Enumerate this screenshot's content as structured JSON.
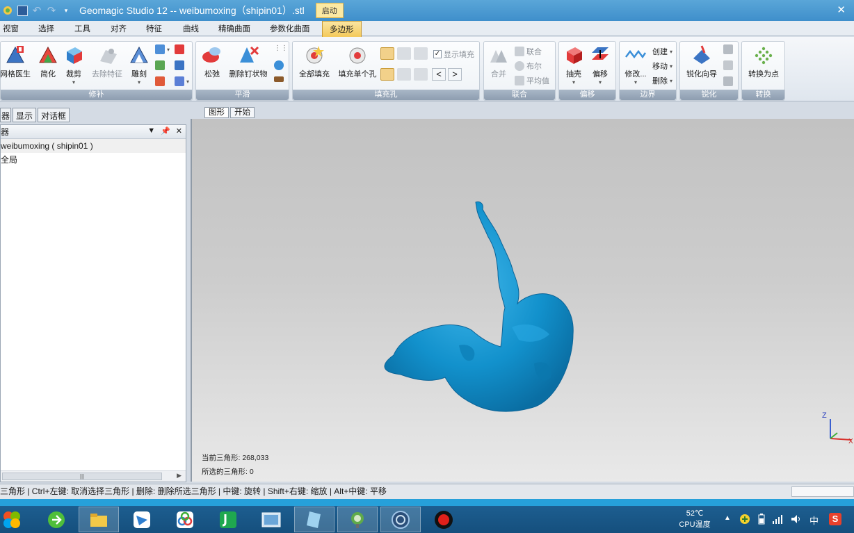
{
  "window": {
    "title": "Geomagic Studio 12 -- weibumoxing（shipin01）.stl",
    "badge": "启动",
    "close_glyph": "✕"
  },
  "menu": {
    "tabs": [
      "视窗",
      "选择",
      "工具",
      "对齐",
      "特征",
      "曲线",
      "精确曲面",
      "参数化曲面",
      "多边形"
    ],
    "active": "多边形"
  },
  "ribbon": {
    "groups": {
      "repair": {
        "label": "修补",
        "items": [
          "网格医生",
          "简化",
          "裁剪",
          "去除特征",
          "雕刻"
        ]
      },
      "smooth": {
        "label": "平滑",
        "items": [
          "松弛",
          "删除钉状物"
        ]
      },
      "fill": {
        "label": "填充孔",
        "items": [
          "全部填充",
          "填充单个孔"
        ],
        "show_fill": "显示填充"
      },
      "merge": {
        "label": "联合",
        "items": [
          "合并",
          "联合",
          "布尔",
          "平均值"
        ]
      },
      "offset": {
        "label": "偏移",
        "items": [
          "抽壳",
          "偏移"
        ]
      },
      "boundary": {
        "label": "边界",
        "items": [
          "修改...",
          "创建",
          "移动",
          "删除"
        ]
      },
      "sharpen": {
        "label": "锐化",
        "items": [
          "锐化向导"
        ]
      },
      "convert": {
        "label": "转换",
        "items": [
          "转换为点"
        ]
      }
    }
  },
  "left_panel": {
    "tabs": [
      "器",
      "显示",
      "对话框"
    ],
    "header": "器",
    "tree": [
      "weibumoxing ( shipin01 )",
      "全局"
    ],
    "scroll_glyph": "|||"
  },
  "view": {
    "tabs": [
      "图形",
      "开始"
    ],
    "active_tab": "图形",
    "current_triangles": "当前三角形: 268,033",
    "selected_triangles": "所选的三角形: 0",
    "axes": {
      "z": "Z",
      "x": "X"
    },
    "model_color": "#1291cc"
  },
  "statusbar": {
    "hint": "三角形 | Ctrl+左键: 取消选择三角形 | 删除: 删除所选三角形 | 中键: 旋转 | Shift+右键: 缩放 | Alt+中键: 平移"
  },
  "taskbar": {
    "temperature": "52℃",
    "temperature_label": "CPU温度",
    "ime": "中",
    "sogou": "S"
  }
}
